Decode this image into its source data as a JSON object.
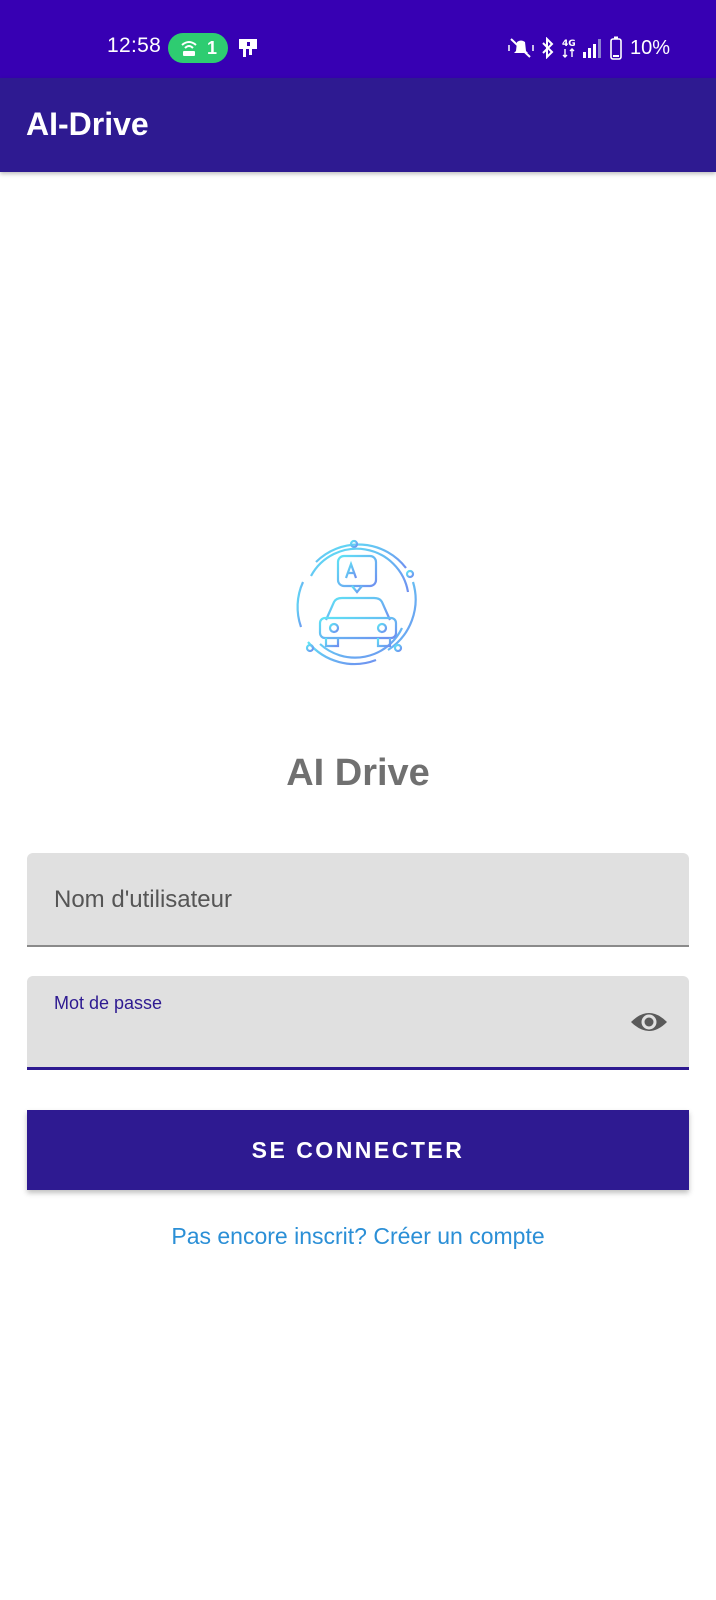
{
  "status_bar": {
    "time": "12:58",
    "hotspot_count": "1",
    "battery_percent": "10%",
    "icons": [
      "hotspot-icon",
      "notification-icon",
      "mute-vibrate-icon",
      "bluetooth-icon",
      "network-4g-icon",
      "signal-icon",
      "battery-icon"
    ]
  },
  "app_bar": {
    "title": "AI-Drive"
  },
  "login": {
    "logo_icon": "ai-car-logo",
    "brand_title": "AI Drive",
    "username": {
      "placeholder": "Nom d'utilisateur",
      "value": ""
    },
    "password": {
      "label": "Mot de passe",
      "value": "",
      "toggle_icon": "eye-icon"
    },
    "submit_label": "SE CONNECTER",
    "signup_link": "Pas encore inscrit? Créer un compte"
  },
  "colors": {
    "status_bar": "#3700b3",
    "primary": "#2e1a91",
    "field_background": "#e0e0e0",
    "link": "#2b8fd6",
    "brand_text": "#707070",
    "hotspot_pill": "#2ecc71"
  }
}
